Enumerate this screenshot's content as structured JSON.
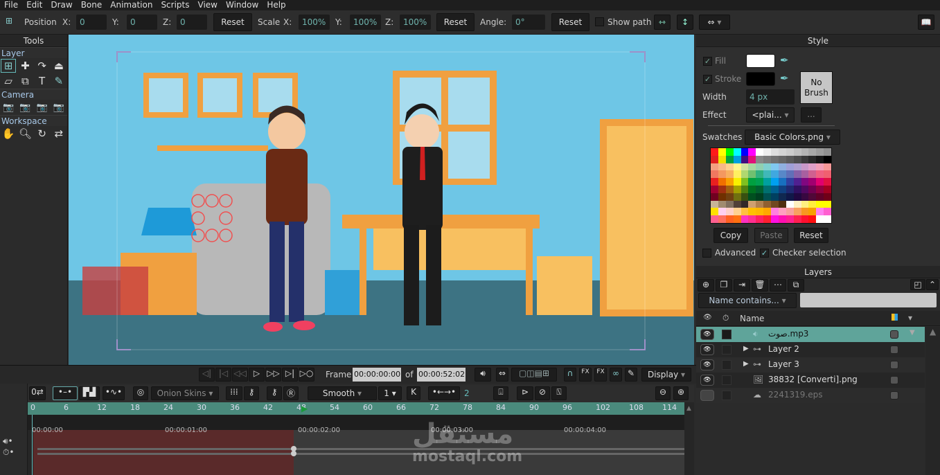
{
  "menu": [
    "File",
    "Edit",
    "Draw",
    "Bone",
    "Animation",
    "Scripts",
    "View",
    "Window",
    "Help"
  ],
  "toolbar": {
    "position_label": "Position",
    "x_label": "X:",
    "y_label": "Y:",
    "z_label": "Z:",
    "pos_x": "0",
    "pos_y": "0",
    "pos_z": "0",
    "reset": "Reset",
    "scale_label": "Scale",
    "scale_x": "100%",
    "scale_y": "100%",
    "scale_z": "100%",
    "angle_label": "Angle:",
    "angle": "0°",
    "show_path": "Show path",
    "show_path_checked": false
  },
  "tools": {
    "title": "Tools",
    "sections": [
      {
        "label": "Layer"
      },
      {
        "label": "Camera"
      },
      {
        "label": "Workspace"
      }
    ]
  },
  "style": {
    "title": "Style",
    "fill_label": "Fill",
    "fill_color": "#ffffff",
    "stroke_label": "Stroke",
    "stroke_color": "#000000",
    "width_label": "Width",
    "width_value": "4 px",
    "brush_label": "No Brush",
    "effect_label": "Effect",
    "effect_value": "<plai...",
    "effect_more": "...",
    "swatches_label": "Swatches",
    "swatches_value": "Basic Colors.png",
    "copy": "Copy",
    "paste": "Paste",
    "reset": "Reset",
    "advanced": "Advanced",
    "advanced_checked": false,
    "checker": "Checker selection",
    "checker_checked": true,
    "swatch_colors": [
      [
        "#ff1a1a",
        "#ffff00",
        "#00ff00",
        "#00ffff",
        "#0000ff",
        "#ff00ff",
        "#ffffff",
        "#eeeeee",
        "#dddddd",
        "#d4d4d4",
        "#cccccc",
        "#c0c0c0",
        "#b4b4b4",
        "#a8a8a8",
        "#9c9c9c",
        "#909090"
      ],
      [
        "#e02020",
        "#f0e000",
        "#00a040",
        "#00a0e0",
        "#401080",
        "#e0107a",
        "#888888",
        "#7c7c7c",
        "#707070",
        "#666666",
        "#5a5a5a",
        "#4c4c4c",
        "#3a3a3a",
        "#2a2a2a",
        "#181818",
        "#000000"
      ],
      [
        "#f4a080",
        "#f8b888",
        "#fcd090",
        "#fff590",
        "#d0e4a0",
        "#a8d8a0",
        "#90d0b0",
        "#80d0d0",
        "#80c8f0",
        "#90b0e0",
        "#a0a0d8",
        "#b0a0d0",
        "#c898c8",
        "#e0a0c8",
        "#f4a0b8",
        "#f89898"
      ],
      [
        "#f07860",
        "#f49860",
        "#f8b060",
        "#fff060",
        "#b0d870",
        "#70c070",
        "#30b080",
        "#40b8b8",
        "#40a8e0",
        "#5888c8",
        "#6070b8",
        "#8860a8",
        "#a860a0",
        "#d06090",
        "#f06080",
        "#f06070"
      ],
      [
        "#e82020",
        "#f07000",
        "#f8a000",
        "#f8f000",
        "#80c020",
        "#00a040",
        "#00a050",
        "#00a0a0",
        "#00a0f0",
        "#1870c0",
        "#3040a0",
        "#502090",
        "#800880",
        "#a00070",
        "#e00070",
        "#e01040"
      ],
      [
        "#a00030",
        "#a03010",
        "#a06010",
        "#a0a000",
        "#508010",
        "#007020",
        "#006030",
        "#007070",
        "#006090",
        "#104080",
        "#202870",
        "#301060",
        "#500860",
        "#700050",
        "#900040",
        "#a00020"
      ],
      [
        "#700020",
        "#703000",
        "#704010",
        "#707010",
        "#385010",
        "#005020",
        "#004020",
        "#005050",
        "#004060",
        "#102850",
        "#101848",
        "#200840",
        "#380840",
        "#500838",
        "#600028",
        "#700018"
      ],
      [
        "#c8b498",
        "#a08c70",
        "#807060",
        "#504038",
        "#302828",
        "#d0a070",
        "#b08050",
        "#906030",
        "#704820",
        "#503010",
        "#ffffff",
        "#fff0c0",
        "#fff080",
        "#ffee40",
        "#ffff00",
        "#ffff00"
      ],
      [
        "#ffe000",
        "#ffd0f0",
        "#ffd0c8",
        "#ffd090",
        "#ffc040",
        "#ffc000",
        "#ffb800",
        "#ffa800",
        "#ff80e0",
        "#ffa0c0",
        "#f8a0a0",
        "#f8a060",
        "#f89820",
        "#f8a000",
        "#ff80f0",
        "#ff60d0"
      ],
      [
        "#ff6090",
        "#ff7060",
        "#ff6020",
        "#ff7010",
        "#ff30c0",
        "#ff3090",
        "#ff2060",
        "#ff2030",
        "#ff10e0",
        "#ff10b0",
        "#ff2090",
        "#ff2050",
        "#ff1030",
        "#ff1010",
        "#ffffff",
        "#ffffff"
      ]
    ]
  },
  "layers": {
    "title": "Layers",
    "filter": "Name contains...",
    "filter_text": "",
    "name_header": "Name",
    "items": [
      {
        "name": "صوت.mp3",
        "type": "audio",
        "selected": true,
        "visible": true,
        "expandable": false
      },
      {
        "name": "Layer 2",
        "type": "bone",
        "selected": false,
        "visible": true,
        "expandable": true
      },
      {
        "name": "Layer 3",
        "type": "bone",
        "selected": false,
        "visible": true,
        "expandable": true
      },
      {
        "name": "38832 [Converti].png",
        "type": "image",
        "selected": false,
        "visible": true,
        "expandable": false
      },
      {
        "name": "2241319.eps",
        "type": "vector",
        "selected": false,
        "visible": false,
        "expandable": false
      }
    ]
  },
  "transport": {
    "frame_label": "Frame",
    "frame": "00:00:00:00",
    "of_label": "of",
    "total": "00:00:52:02",
    "display": "Display"
  },
  "timeline": {
    "onion": "Onion Skins",
    "interp": "Smooth",
    "interp_num": "1",
    "key_num": "2",
    "ruler": [
      "0",
      "6",
      "12",
      "18",
      "24",
      "30",
      "36",
      "42",
      "48",
      "54",
      "60",
      "66",
      "72",
      "78",
      "84",
      "90",
      "96",
      "102",
      "108",
      "114"
    ],
    "time_marks": [
      "00:00:00",
      "00:00:01:00",
      "00:00:02:00",
      "00:00:03:00",
      "00:00:04:00"
    ]
  },
  "watermark": {
    "arabic": "مستقل",
    "latin": "mostaql.com"
  }
}
